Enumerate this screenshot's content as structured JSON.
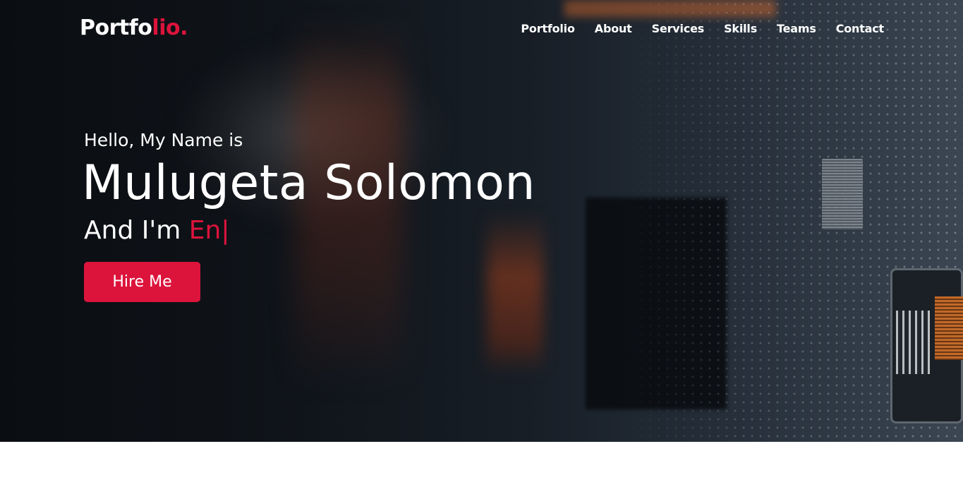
{
  "header": {
    "logo_main": "Portfo",
    "logo_accent": "lio.",
    "nav": [
      {
        "label": "Portfolio"
      },
      {
        "label": "About"
      },
      {
        "label": "Services"
      },
      {
        "label": "Skills"
      },
      {
        "label": "Teams"
      },
      {
        "label": "Contact"
      }
    ]
  },
  "hero": {
    "greeting": "Hello, My Name is",
    "name": "Mulugeta Solomon",
    "role_prefix": "And I'm ",
    "role_typed": "En",
    "cursor": "|",
    "cta_label": "Hire Me"
  },
  "colors": {
    "accent": "#dc143c",
    "text": "#ffffff",
    "hero_background": "#0f1216"
  }
}
